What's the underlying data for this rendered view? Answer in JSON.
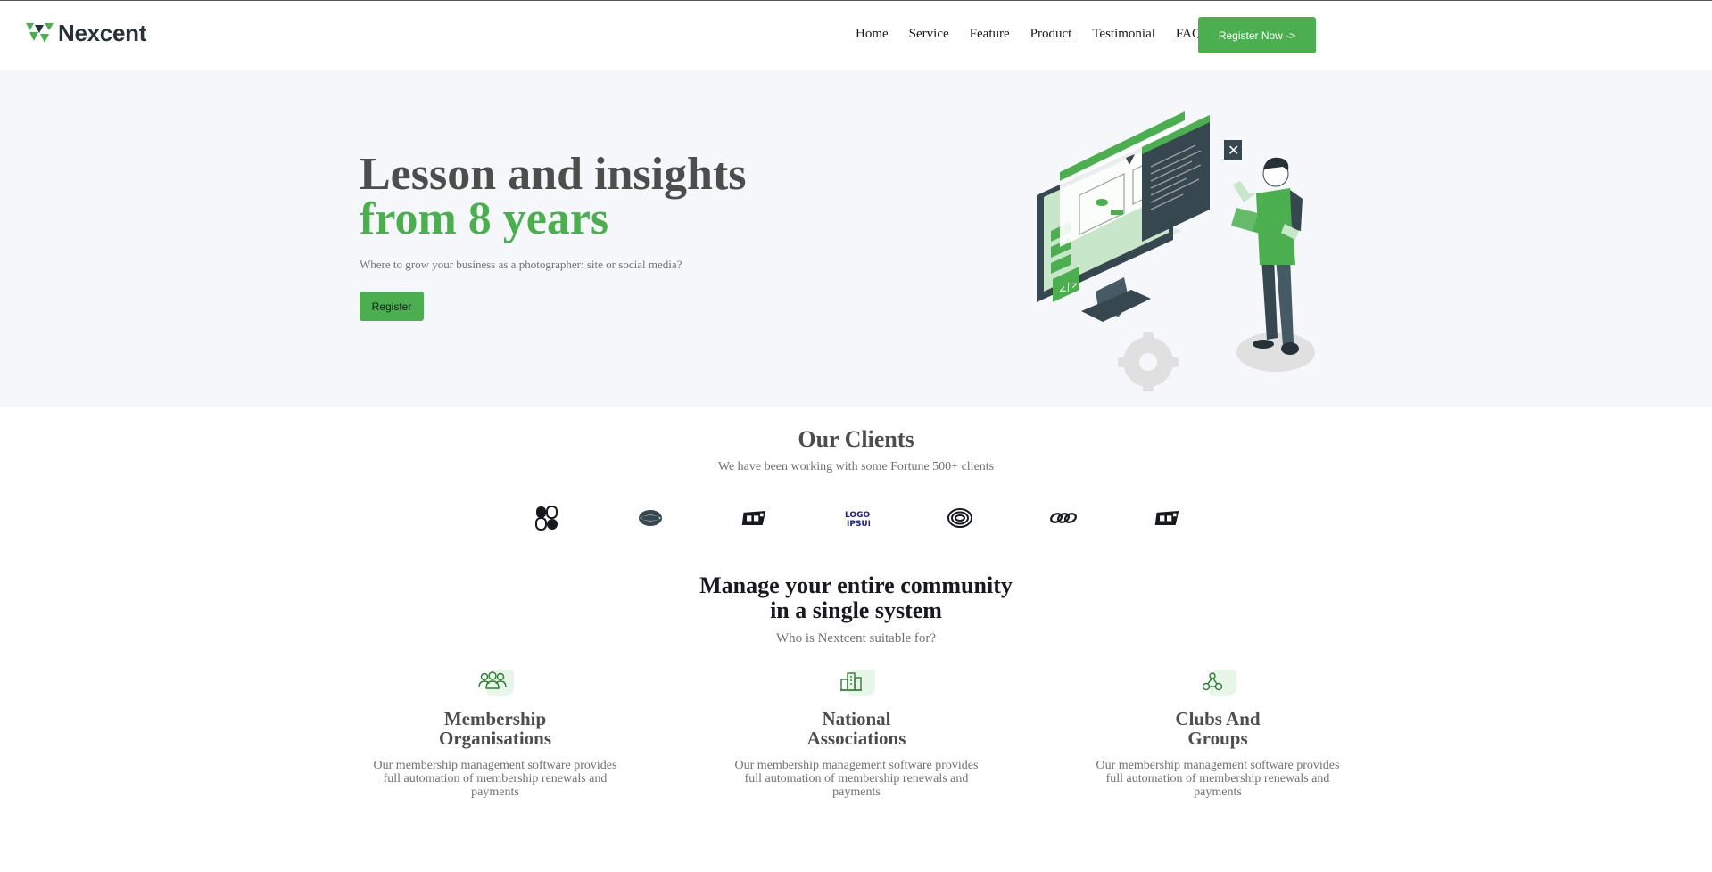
{
  "brand": {
    "name": "Nexcent",
    "accent": "#4caf4f",
    "dark": "#263238"
  },
  "nav": {
    "items": [
      "Home",
      "Service",
      "Feature",
      "Product",
      "Testimonial",
      "FAQ"
    ],
    "cta": "Register Now ->"
  },
  "hero": {
    "title_line1": "Lesson and insights",
    "title_line2": "from 8 years",
    "subtitle": "Where to grow your business as a photographer: site or social media?",
    "button": "Register",
    "illustration": "developer-monitor-illustration"
  },
  "clients": {
    "title": "Our Clients",
    "subtitle": "We have been working with some Fortune 500+ clients",
    "logos": [
      "client-logo-1",
      "client-logo-2",
      "client-logo-3",
      "client-logo-4",
      "client-logo-5",
      "client-logo-6",
      "client-logo-7"
    ]
  },
  "community": {
    "title_line1": "Manage your entire community",
    "title_line2": "in a single system",
    "subtitle": "Who is Nextcent suitable for?",
    "cards": [
      {
        "icon": "users-icon",
        "title_line1": "Membership",
        "title_line2": "Organisations",
        "text": "Our membership management software provides full automation of membership renewals and payments"
      },
      {
        "icon": "building-icon",
        "title_line1": "National",
        "title_line2": "Associations",
        "text": "Our membership management software provides full automation of membership renewals and payments"
      },
      {
        "icon": "network-icon",
        "title_line1": "Clubs And",
        "title_line2": "Groups",
        "text": "Our membership management software provides full automation of membership renewals and payments"
      }
    ]
  }
}
